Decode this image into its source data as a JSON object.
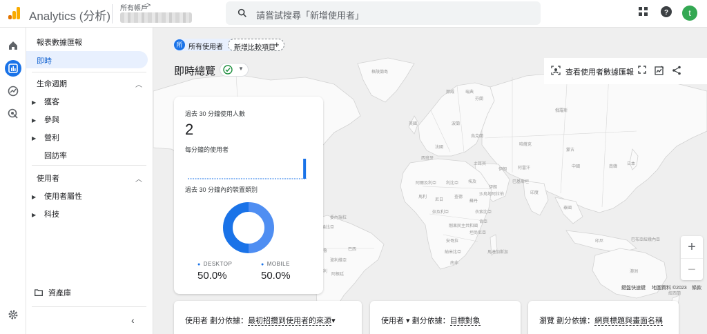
{
  "app": {
    "title": "Analytics (分析)",
    "account_label": "所有帳戶",
    "account_chevron": ">"
  },
  "search": {
    "placeholder": "請嘗試搜尋「新增使用者」"
  },
  "user": {
    "avatar_letter": "t"
  },
  "nav": {
    "heading": "報表數據匯報",
    "active_item": "即時",
    "sections": [
      {
        "label": "生命週期",
        "items": [
          "獲客",
          "參與",
          "營利"
        ],
        "extra": "回訪率"
      },
      {
        "label": "使用者",
        "items": [
          "使用者屬性",
          "科技"
        ]
      }
    ],
    "library": "資產庫"
  },
  "compare": {
    "all_users": "所有使用者",
    "all_users_badge": "所",
    "add_compare": "新增比較項目"
  },
  "page": {
    "title": "即時總覽"
  },
  "toolbar": {
    "view_snapshot": "查看使用者數據匯報"
  },
  "realtime_card": {
    "users_label": "過去 30 分鐘使用人數",
    "users_value": "2",
    "per_minute_label": "每分鐘的使用者",
    "device_label": "過去 30 分鐘內的裝置類別",
    "devices": [
      {
        "name": "DESKTOP",
        "pct": "50.0%"
      },
      {
        "name": "MOBILE",
        "pct": "50.0%"
      }
    ]
  },
  "map": {
    "labels": [
      "格陵蘭島",
      "挪威",
      "瑞典",
      "芬蘭",
      "俄羅斯",
      "英國",
      "波蘭",
      "烏克蘭",
      "哈薩克",
      "蒙古",
      "法國",
      "西班牙",
      "土耳其",
      "伊朗",
      "阿富汗",
      "中國",
      "日本",
      "南韓",
      "巴基斯坦",
      "印度",
      "泰國",
      "阿爾及利亞",
      "利比亞",
      "埃及",
      "伊朗",
      "沙烏地阿拉伯",
      "馬利",
      "尼日",
      "查德",
      "蘇丹",
      "衣索比亞",
      "奈及利亞",
      "肯亞",
      "剛果民主共和國",
      "坦尚尼亞",
      "安哥拉",
      "納米比亞",
      "南非",
      "馬達加斯加",
      "巴西",
      "祕魯",
      "玻利維亞",
      "阿根廷",
      "智利",
      "委內瑞拉",
      "哥倫比亞",
      "印尼",
      "巴布亞紐幾內亞",
      "澳洲",
      "紐西蘭"
    ],
    "attribution": [
      "鍵盤快速鍵",
      "地圖資料 ©2023",
      "條款"
    ]
  },
  "bottom_cards": [
    {
      "prefix": "使用者 劃分依據：",
      "value": "最初招攬到使用者的來源"
    },
    {
      "prefix": "使用者 ▾ 劃分依據：",
      "value": "目標對象"
    },
    {
      "prefix": "瀏覽 劃分依據：",
      "value": "網頁標題與畫面名稱"
    }
  ],
  "colors": {
    "accent": "#1a73e8",
    "donut_light": "#4f8ef2",
    "donut_dark": "#1a73e8",
    "check": "#1e8e3e"
  },
  "chart_data": {
    "type": "bar",
    "title": "每分鐘的使用者",
    "values": [
      0,
      0,
      0,
      0,
      0,
      0,
      0,
      0,
      0,
      0,
      0,
      0,
      0,
      0,
      0,
      0,
      0,
      0,
      0,
      0,
      0,
      0,
      0,
      0,
      0,
      0,
      0,
      0,
      0,
      2
    ]
  },
  "donut_data": {
    "type": "pie",
    "categories": [
      "DESKTOP",
      "MOBILE"
    ],
    "values": [
      50.0,
      50.0
    ]
  }
}
